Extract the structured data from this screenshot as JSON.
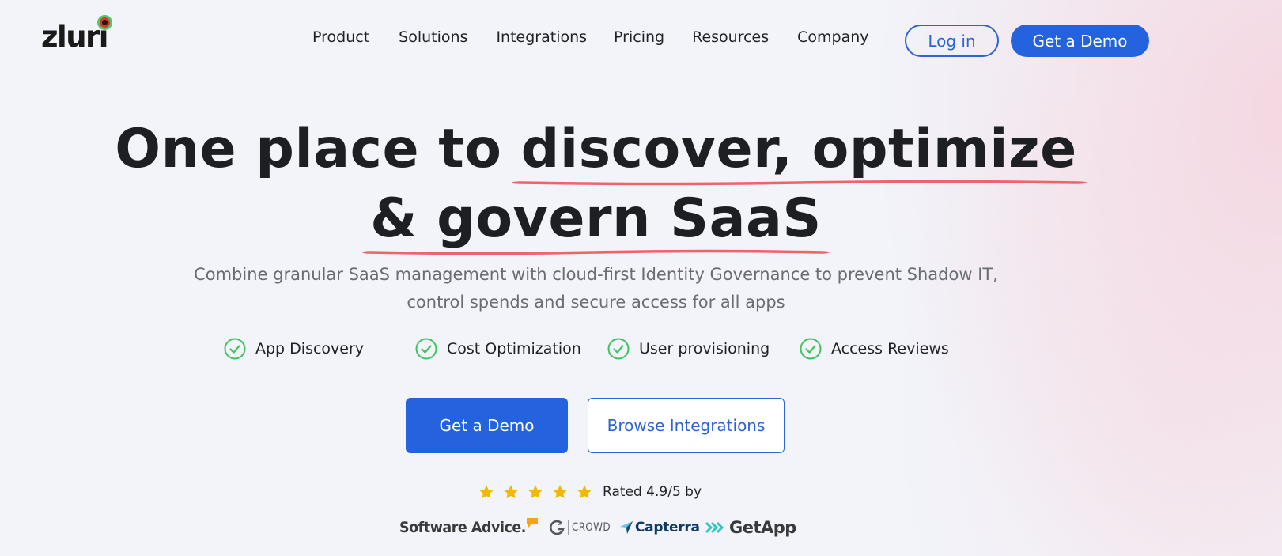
{
  "header": {
    "logo_text": "zluri",
    "nav": [
      "Product",
      "Solutions",
      "Integrations",
      "Pricing",
      "Resources",
      "Company"
    ],
    "login_label": "Log in",
    "demo_label": "Get a Demo"
  },
  "hero": {
    "headline_part1": "One place to ",
    "headline_highlight1": "discover, optimize",
    "headline_highlight2": "& govern SaaS",
    "subtitle": "Combine granular SaaS management with cloud-first Identity Governance to prevent Shadow IT, control spends and secure access for all apps",
    "features": [
      "App Discovery",
      "Cost Optimization",
      "User provisioning",
      "Access Reviews"
    ],
    "primary_cta": "Get a Demo",
    "secondary_cta": "Browse Integrations"
  },
  "rating": {
    "stars": 5,
    "text": "Rated 4.9/5 by"
  },
  "review_sites": {
    "software_advice": "Software Advice.",
    "g2": "CROWD",
    "capterra": "Capterra",
    "getapp": "GetApp"
  },
  "colors": {
    "brand_blue": "#2563de",
    "check_green": "#3fc35f",
    "star_yellow": "#f5b800",
    "underline_red": "#f0636a"
  }
}
